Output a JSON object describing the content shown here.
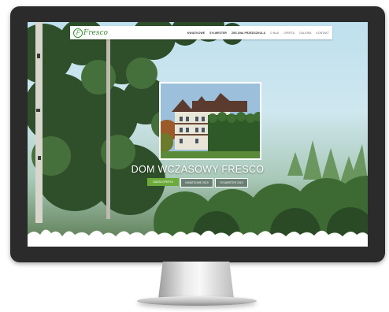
{
  "site": {
    "logo_text": "Fresco",
    "nav": [
      "KWIATKOWE",
      "SYLWESTER",
      "ZIELONA PRZEDSZKOLA",
      "O NAS",
      "OFERTA",
      "GALERIA",
      "KONTAKT"
    ],
    "hero_title": "DOM WCZASOWY FRESCO",
    "buttons": {
      "primary": "NASZA OFERTA",
      "second": "KWIATKOWE 2019",
      "third": "SYLWESTER 2019"
    }
  },
  "colors": {
    "brand_green": "#3f8f3a",
    "button_green": "#6cab3a",
    "monitor_bezel": "#2b2b2b"
  }
}
